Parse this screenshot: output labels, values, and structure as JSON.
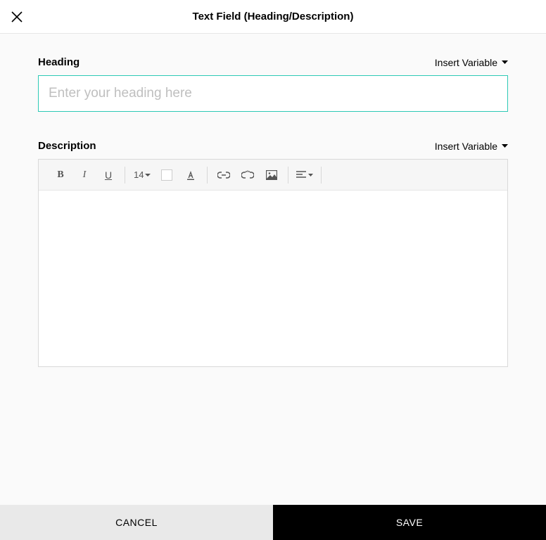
{
  "header": {
    "title": "Text Field (Heading/Description)"
  },
  "heading": {
    "label": "Heading",
    "insert_variable": "Insert Variable",
    "placeholder": "Enter your heading here",
    "value": ""
  },
  "description": {
    "label": "Description",
    "insert_variable": "Insert Variable",
    "toolbar": {
      "font_size": "14"
    },
    "value": ""
  },
  "footer": {
    "cancel": "CANCEL",
    "save": "SAVE"
  }
}
